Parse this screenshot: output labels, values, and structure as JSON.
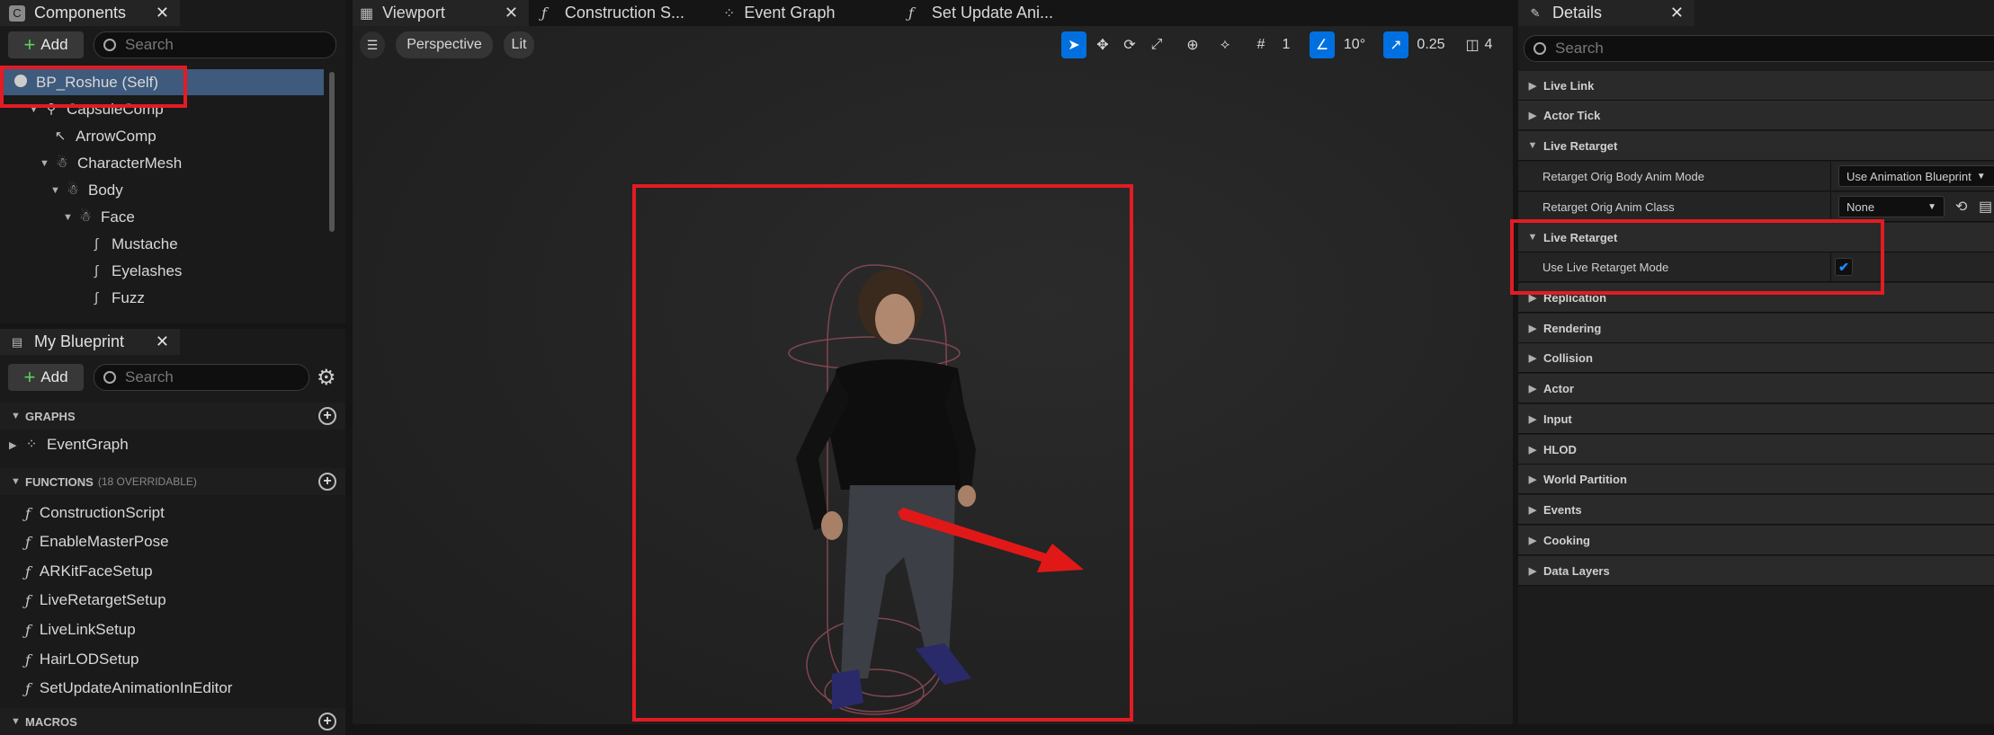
{
  "components": {
    "tab_title": "Components",
    "close": "✕",
    "add_label": "Add",
    "search_placeholder": "Search",
    "tree": [
      {
        "label": "BP_Roshue (Self)",
        "icon": "actor-icon"
      },
      {
        "label": "CapsuleComp",
        "icon": "capsule-icon"
      },
      {
        "label": "ArrowComp",
        "icon": "arrow-icon"
      },
      {
        "label": "CharacterMesh",
        "icon": "skeleton-icon"
      },
      {
        "label": "Body",
        "icon": "skeleton-icon"
      },
      {
        "label": "Face",
        "icon": "skeleton-icon"
      },
      {
        "label": "Mustache",
        "icon": "groom-icon"
      },
      {
        "label": "Eyelashes",
        "icon": "groom-icon"
      },
      {
        "label": "Fuzz",
        "icon": "groom-icon"
      }
    ]
  },
  "my_blueprint": {
    "tab_title": "My Blueprint",
    "close": "✕",
    "add_label": "Add",
    "search_placeholder": "Search",
    "graphs_header": "GRAPHS",
    "graphs": [
      "EventGraph"
    ],
    "functions_header": "FUNCTIONS",
    "functions_sub": "(18 OVERRIDABLE)",
    "functions": [
      "ConstructionScript",
      "EnableMasterPose",
      "ARKitFaceSetup",
      "LiveRetargetSetup",
      "LiveLinkSetup",
      "HairLODSetup",
      "SetUpdateAnimationInEditor"
    ],
    "macros_header": "MACROS"
  },
  "editor_tabs": {
    "viewport": "Viewport",
    "close": "✕",
    "construction": "Construction S...",
    "event_graph": "Event Graph",
    "set_update": "Set Update Ani..."
  },
  "viewport_toolbar": {
    "perspective": "Perspective",
    "lit": "Lit",
    "grid_value": "1",
    "angle_value": "10°",
    "scale_value": "0.25",
    "camera_value": "4"
  },
  "details": {
    "tab_title": "Details",
    "close": "✕",
    "search_placeholder": "Search",
    "rows": [
      {
        "type": "category",
        "label": "Live Link",
        "expanded": false
      },
      {
        "type": "category",
        "label": "Actor Tick",
        "expanded": false
      },
      {
        "type": "category",
        "label": "Live Retarget",
        "expanded": true
      },
      {
        "type": "property",
        "label": "Retarget Orig Body Anim Mode",
        "value": "Use Animation Blueprint"
      },
      {
        "type": "property",
        "label": "Retarget Orig Anim Class",
        "value": "None"
      },
      {
        "type": "category",
        "label": "Live Retarget",
        "expanded": true
      },
      {
        "type": "property",
        "label": "Use Live Retarget Mode",
        "value": "checked"
      },
      {
        "type": "category",
        "label": "Replication",
        "expanded": false
      },
      {
        "type": "category",
        "label": "Rendering",
        "expanded": false
      },
      {
        "type": "category",
        "label": "Collision",
        "expanded": false
      },
      {
        "type": "category",
        "label": "Actor",
        "expanded": false
      },
      {
        "type": "category",
        "label": "Input",
        "expanded": false
      },
      {
        "type": "category",
        "label": "HLOD",
        "expanded": false
      },
      {
        "type": "category",
        "label": "World Partition",
        "expanded": false
      },
      {
        "type": "category",
        "label": "Events",
        "expanded": false
      },
      {
        "type": "category",
        "label": "Cooking",
        "expanded": false
      },
      {
        "type": "category",
        "label": "Data Layers",
        "expanded": false
      }
    ]
  },
  "colors": {
    "accent": "#0070e0",
    "highlight": "#e31b23",
    "selected_row": "#3e5a7c"
  }
}
